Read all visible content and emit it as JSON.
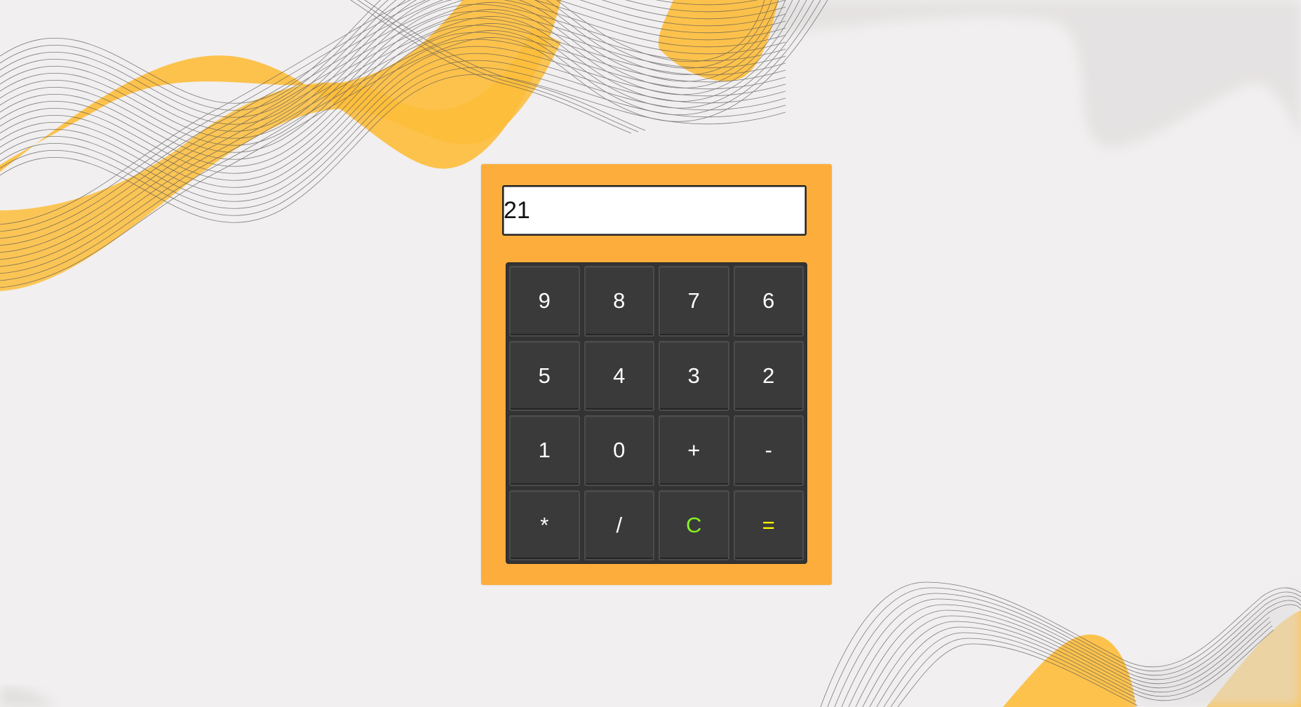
{
  "calculator": {
    "display_value": "21",
    "keys": [
      {
        "label": "9",
        "kind": "digit"
      },
      {
        "label": "8",
        "kind": "digit"
      },
      {
        "label": "7",
        "kind": "digit"
      },
      {
        "label": "6",
        "kind": "digit"
      },
      {
        "label": "5",
        "kind": "digit"
      },
      {
        "label": "4",
        "kind": "digit"
      },
      {
        "label": "3",
        "kind": "digit"
      },
      {
        "label": "2",
        "kind": "digit"
      },
      {
        "label": "1",
        "kind": "digit"
      },
      {
        "label": "0",
        "kind": "digit"
      },
      {
        "label": "+",
        "kind": "operator"
      },
      {
        "label": "-",
        "kind": "operator"
      },
      {
        "label": "*",
        "kind": "operator"
      },
      {
        "label": "/",
        "kind": "operator"
      },
      {
        "label": "C",
        "kind": "clear"
      },
      {
        "label": "=",
        "kind": "equals"
      }
    ]
  },
  "colors": {
    "background": "#f1efef",
    "calculator_body": "#fdad3c",
    "keypad": "#333333",
    "key": "#3a3a3a",
    "key_text": "#ffffff",
    "clear_text": "#86f025",
    "equals_text": "#ffff00",
    "wave_accent": "#fdbd3a"
  }
}
